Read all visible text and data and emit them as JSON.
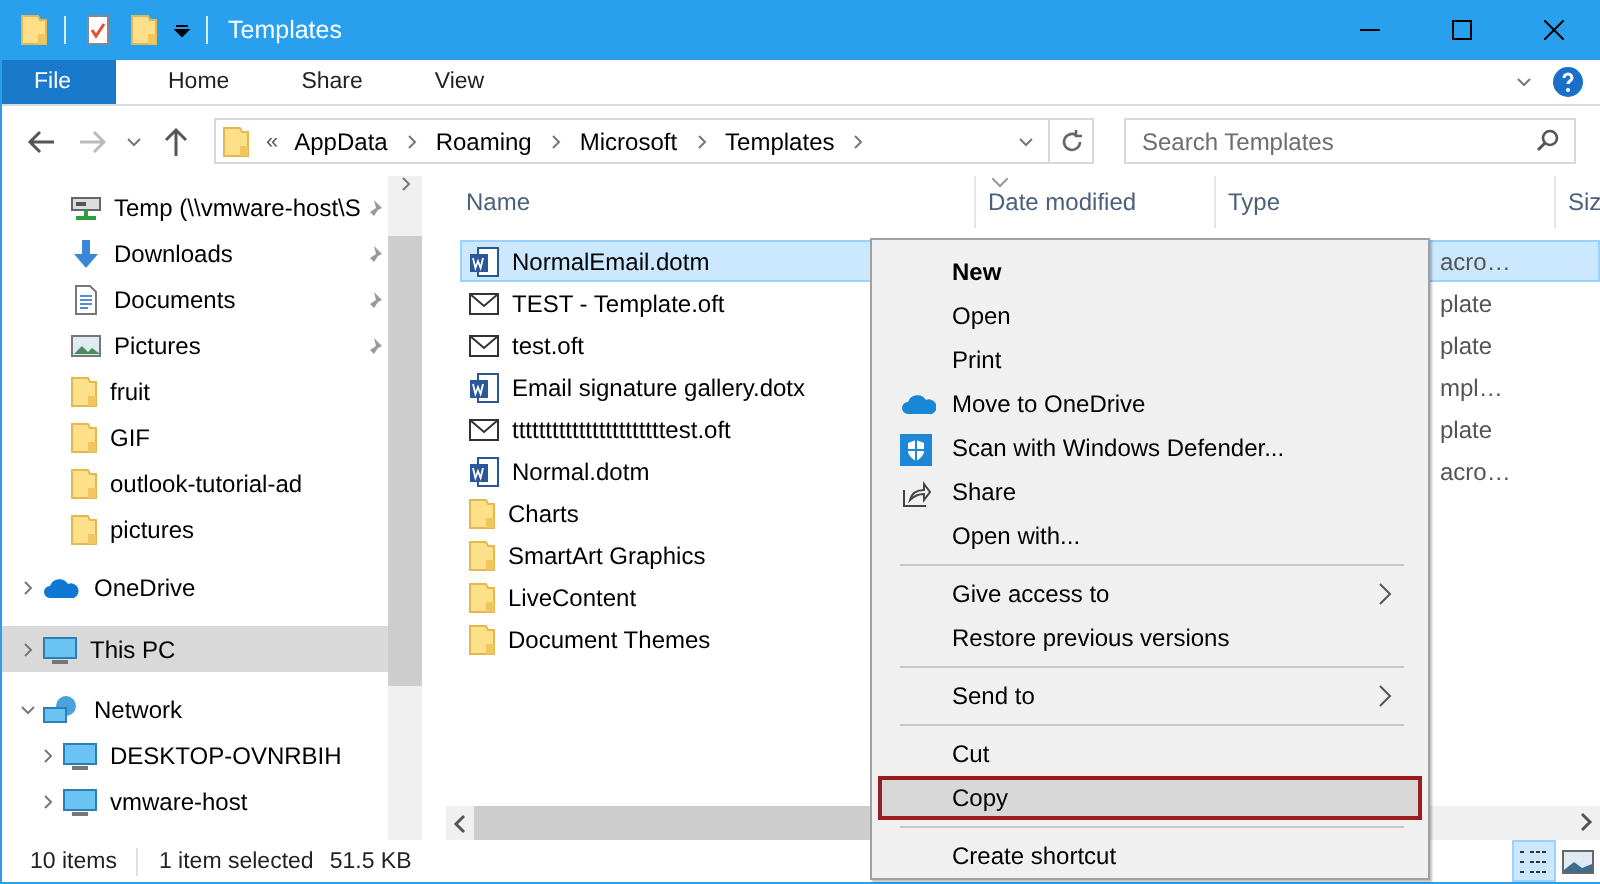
{
  "window": {
    "title": "Templates"
  },
  "ribbon": {
    "tabs": [
      {
        "label": "File",
        "kind": "file"
      },
      {
        "label": "Home",
        "kind": "tab"
      },
      {
        "label": "Share",
        "kind": "tab"
      },
      {
        "label": "View",
        "kind": "tab"
      }
    ]
  },
  "address": {
    "overflow": "«",
    "crumbs": [
      "AppData",
      "Roaming",
      "Microsoft",
      "Templates"
    ]
  },
  "search": {
    "placeholder": "Search Templates"
  },
  "sidebar": {
    "pinned_items": [
      {
        "label": "Temp (\\\\vmware-host\\S",
        "kind": "drive",
        "pinned": true
      },
      {
        "label": "Downloads",
        "kind": "download",
        "pinned": true
      },
      {
        "label": "Documents",
        "kind": "document",
        "pinned": true
      },
      {
        "label": "Pictures",
        "kind": "image",
        "pinned": true
      },
      {
        "label": "fruit",
        "kind": "folder",
        "pinned": false
      },
      {
        "label": "GIF",
        "kind": "folder",
        "pinned": false
      },
      {
        "label": "outlook-tutorial-ad",
        "kind": "folder",
        "pinned": false
      },
      {
        "label": "pictures",
        "kind": "folder",
        "pinned": false
      }
    ],
    "tree": [
      {
        "label": "OneDrive",
        "kind": "cloud",
        "expanded": false,
        "selected": false
      },
      {
        "label": "This PC",
        "kind": "computer",
        "expanded": false,
        "selected": true
      },
      {
        "label": "Network",
        "kind": "network",
        "expanded": true,
        "selected": false,
        "children": [
          {
            "label": "DESKTOP-OVNRBIH",
            "kind": "computer",
            "expanded": false,
            "selected": false
          },
          {
            "label": "vmware-host",
            "kind": "computer",
            "expanded": false,
            "selected": false
          }
        ]
      }
    ]
  },
  "table": {
    "columns": [
      {
        "label": "Name",
        "sorted": false
      },
      {
        "label": "Date modified",
        "sorted": true
      },
      {
        "label": "Type",
        "sorted": false
      },
      {
        "label": "Siz",
        "sorted": false
      }
    ],
    "rows": [
      {
        "name": "NormalEmail.dotm",
        "kind": "word",
        "type": "acro…",
        "selected": true
      },
      {
        "name": "TEST - Template.oft",
        "kind": "mail",
        "type": "plate",
        "selected": false
      },
      {
        "name": "test.oft",
        "kind": "mail",
        "type": "plate",
        "selected": false
      },
      {
        "name": "Email signature gallery.dotx",
        "kind": "word",
        "type": "mpl…",
        "selected": false
      },
      {
        "name": "tttttttttttttttttttttttest.oft",
        "kind": "mail",
        "type": "plate",
        "selected": false
      },
      {
        "name": "Normal.dotm",
        "kind": "word",
        "type": "acro…",
        "selected": false
      },
      {
        "name": "Charts",
        "kind": "folder",
        "selected": false
      },
      {
        "name": "SmartArt Graphics",
        "kind": "folder",
        "selected": false
      },
      {
        "name": "LiveContent",
        "kind": "folder",
        "selected": false
      },
      {
        "name": "Document Themes",
        "kind": "folder",
        "selected": false
      }
    ]
  },
  "context_menu": {
    "items": [
      {
        "label": "New",
        "kind": "plain",
        "default": true,
        "selected": false
      },
      {
        "label": "Open",
        "kind": "plain",
        "default": false,
        "selected": false
      },
      {
        "label": "Print",
        "kind": "plain",
        "default": false,
        "selected": false
      },
      {
        "label": "Move to OneDrive",
        "kind": "cloud",
        "default": false,
        "selected": false
      },
      {
        "label": "Scan with Windows Defender...",
        "kind": "shield",
        "default": false,
        "selected": false
      },
      {
        "label": "Share",
        "kind": "share",
        "default": false,
        "selected": false
      },
      {
        "label": "Open with...",
        "kind": "plain",
        "default": false,
        "selected": false
      },
      {
        "kind": "separator"
      },
      {
        "label": "Give access to",
        "kind": "submenu",
        "default": false,
        "selected": false
      },
      {
        "label": "Restore previous versions",
        "kind": "plain",
        "default": false,
        "selected": false
      },
      {
        "kind": "separator"
      },
      {
        "label": "Send to",
        "kind": "submenu",
        "default": false,
        "selected": false
      },
      {
        "kind": "separator"
      },
      {
        "label": "Cut",
        "kind": "plain",
        "default": false,
        "selected": false
      },
      {
        "label": "Copy",
        "kind": "plain",
        "default": false,
        "selected": true
      },
      {
        "kind": "separator"
      },
      {
        "label": "Create shortcut",
        "kind": "plain",
        "default": false,
        "selected": false
      }
    ]
  },
  "status_bar": {
    "count": "10 items",
    "selection": "1 item selected",
    "size": "51.5 KB",
    "views": [
      {
        "kind": "details",
        "selected": true
      },
      {
        "kind": "large",
        "selected": false
      }
    ]
  }
}
